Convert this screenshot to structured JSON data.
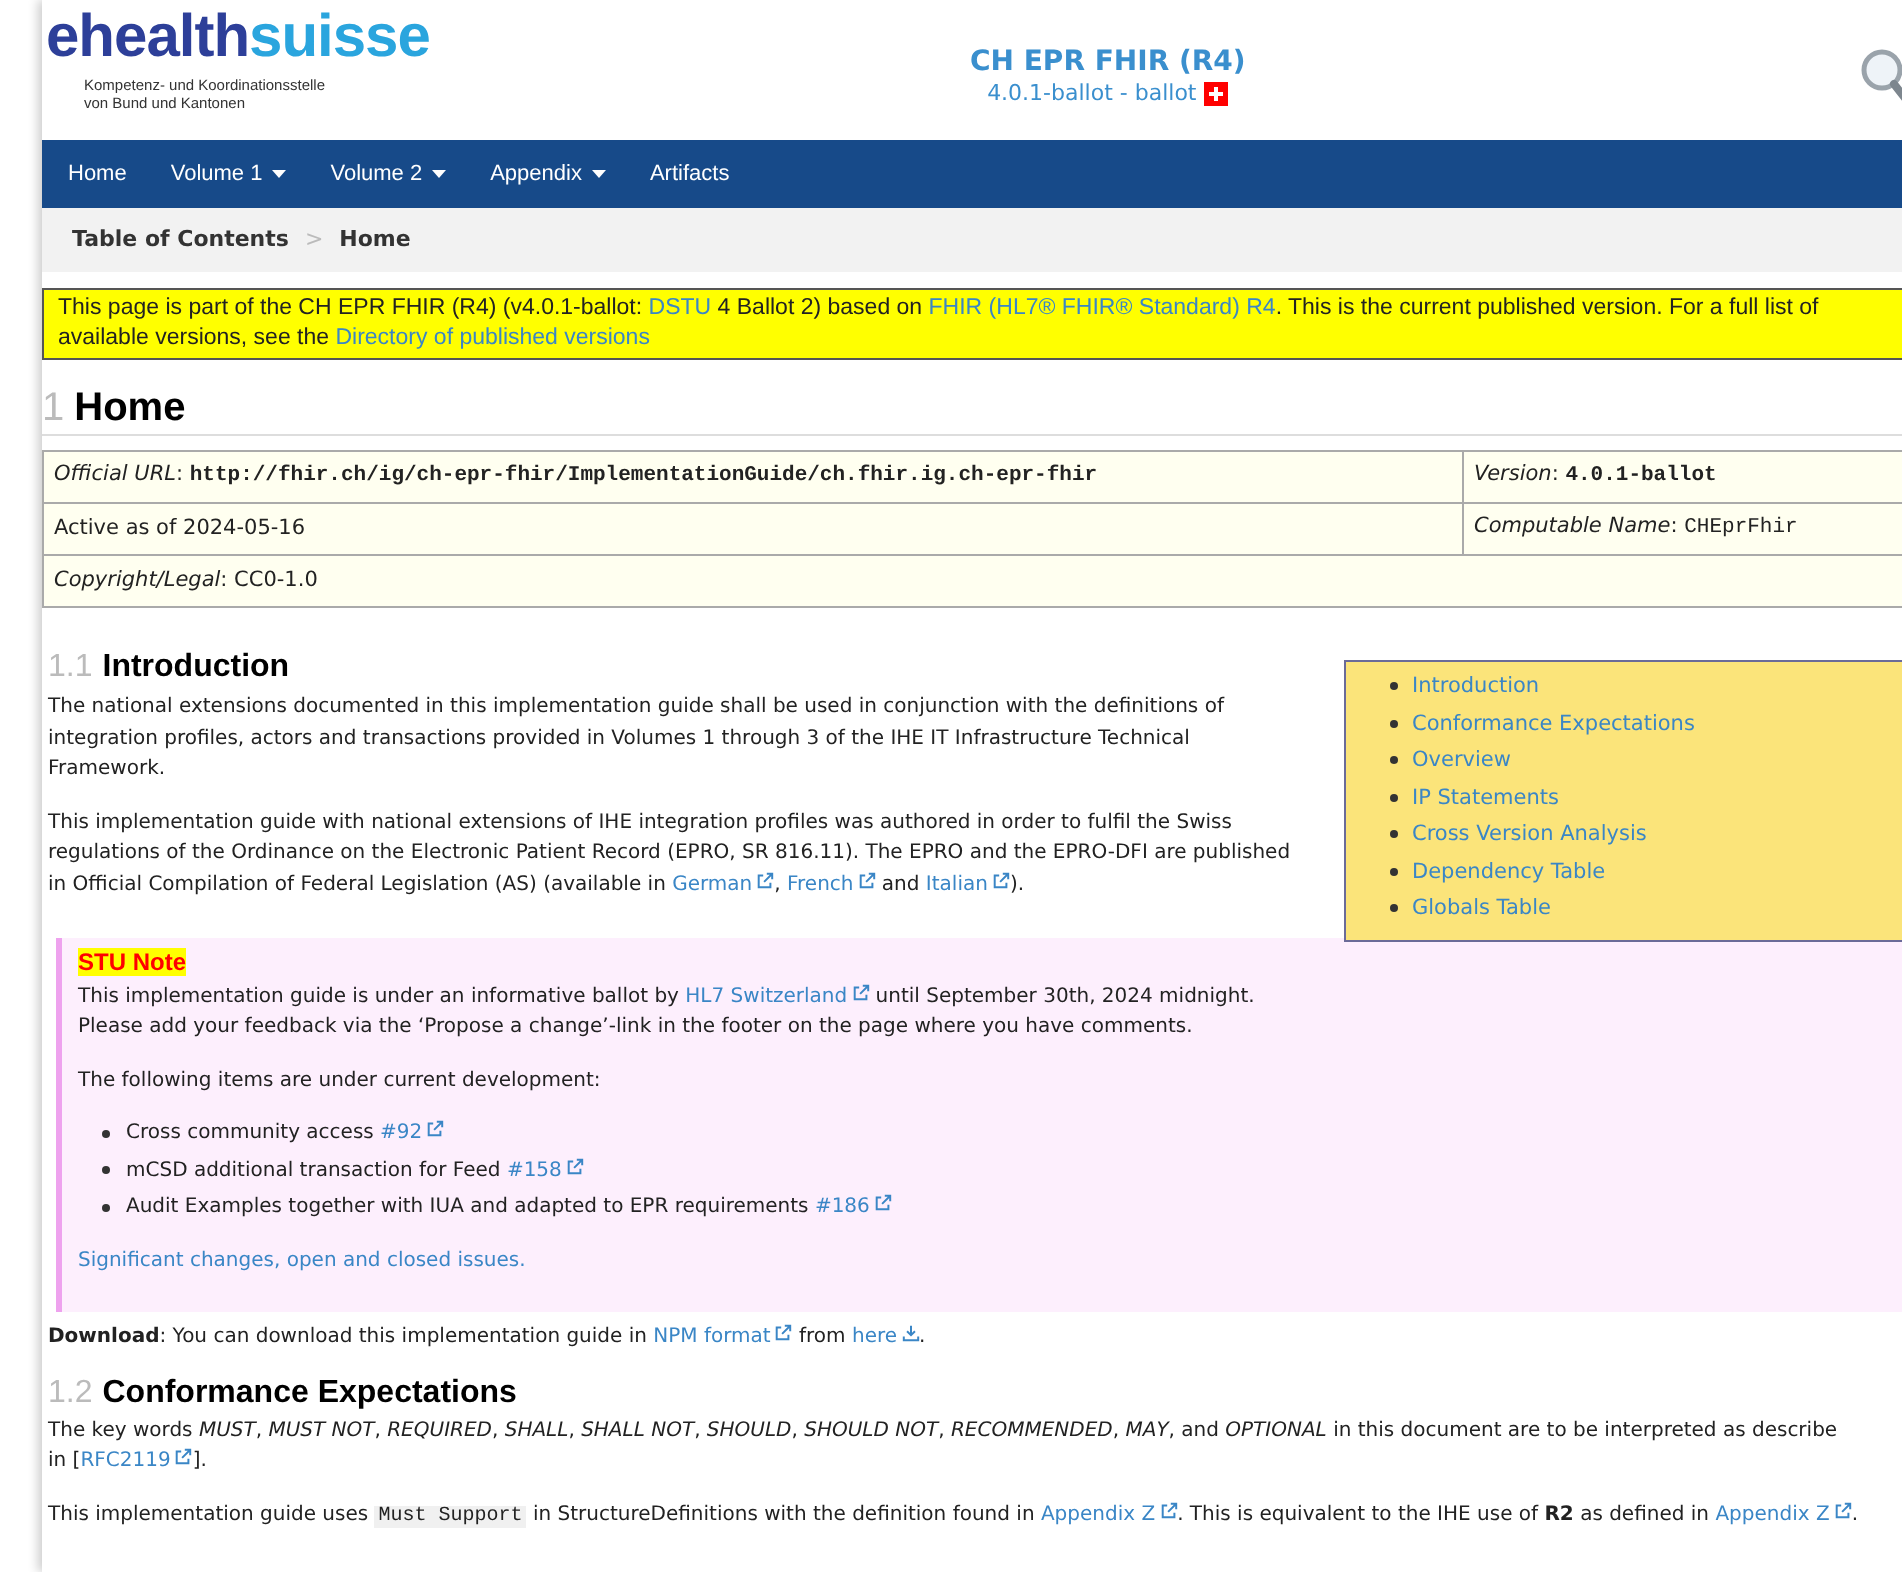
{
  "header": {
    "logo_main": "ehealth",
    "logo_accent": "suisse",
    "logo_subtitle": [
      "Kompetenz- und Koordinationsstelle",
      "von Bund und Kantonen"
    ],
    "title": "CH EPR FHIR (R4)",
    "version": "4.0.1-ballot - ballot"
  },
  "nav": [
    {
      "label": "Home",
      "dropdown": false
    },
    {
      "label": "Volume 1",
      "dropdown": true
    },
    {
      "label": "Volume 2",
      "dropdown": true
    },
    {
      "label": "Appendix",
      "dropdown": true
    },
    {
      "label": "Artifacts",
      "dropdown": false
    }
  ],
  "breadcrumb": {
    "items": [
      "Table of Contents",
      "Home"
    ],
    "separator": ">"
  },
  "banner": [
    [
      "This page is part of the CH EPR FHIR (R4) (v4.0.1-ballot: ",
      {
        "kind": "link",
        "text": "DSTU"
      },
      " 4 Ballot 2) based on ",
      {
        "kind": "link",
        "text": "FHIR (HL7® FHIR® Standard) R4"
      },
      ". This is the current published version. For a full list of"
    ],
    [
      "available versions, see the ",
      {
        "kind": "link",
        "text": "Directory of published versions"
      }
    ]
  ],
  "page_heading": {
    "number": "1",
    "title": "Home"
  },
  "metadata_table": [
    [
      [
        "*Official URL*: ",
        {
          "kind": "mono",
          "text": "**http://fhir.ch/ig/ch-epr-fhir/ImplementationGuide/ch.fhir.ig.ch-epr-fhir**"
        }
      ],
      [
        "*Version*: ",
        {
          "kind": "mono",
          "text": "**4.0.1-ballot**"
        }
      ]
    ],
    [
      [
        "Active as of 2024-05-16"
      ],
      [
        "*Computable Name*: ",
        {
          "kind": "mono",
          "text": "CHEprFhir"
        }
      ]
    ],
    [
      [
        "*Copyright/Legal*: CC0-1.0"
      ]
    ]
  ],
  "intro": {
    "number": "1.1",
    "title": "Introduction",
    "paragraphs": [
      [
        [
          "The national extensions documented in this implementation guide shall be used in conjunction with the definitions of"
        ],
        [
          "integration profiles, actors and transactions provided in Volumes 1 through 3 of the IHE IT Infrastructure Technical"
        ],
        [
          "Framework."
        ]
      ],
      [
        [
          "This implementation guide with national extensions of IHE integration profiles was authored in order to fulfil the Swiss"
        ],
        [
          "regulations of the Ordinance on the Electronic Patient Record (EPRO, SR 816.11). The EPRO and the EPRO-DFI are published"
        ],
        [
          "in Official Compilation of Federal Legislation (AS) (available in ",
          {
            "kind": "extlink",
            "text": "German"
          },
          ", ",
          {
            "kind": "extlink",
            "text": "French"
          },
          " and ",
          {
            "kind": "extlink",
            "text": "Italian"
          },
          ")."
        ]
      ]
    ]
  },
  "toc": [
    "Introduction",
    "Conformance Expectations",
    "Overview",
    "IP Statements",
    "Cross Version Analysis",
    "Dependency Table",
    "Globals Table"
  ],
  "stu_note": {
    "label": "STU Note",
    "blocks": [
      {
        "kind": "paragraph",
        "lines": [
          [
            "This implementation guide is under an informative ballot by ",
            {
              "kind": "extlink",
              "text": "HL7 Switzerland"
            },
            " until September 30th, 2024 midnight."
          ],
          [
            "Please add your feedback via the ‘Propose a change’-link in the footer on the page where you have comments."
          ]
        ]
      },
      {
        "kind": "paragraph",
        "lines": [
          [
            "The following items are under current development:"
          ]
        ]
      },
      {
        "kind": "list",
        "items": [
          [
            "Cross community access ",
            {
              "kind": "extlink",
              "text": "#92"
            }
          ],
          [
            "mCSD additional transaction for Feed ",
            {
              "kind": "extlink",
              "text": "#158"
            }
          ],
          [
            "Audit Examples together with IUA and adapted to EPR requirements ",
            {
              "kind": "extlink",
              "text": "#186"
            }
          ]
        ]
      },
      {
        "kind": "link",
        "text": "Significant changes, open and closed issues."
      }
    ]
  },
  "download": [
    [
      "**Download**: You can download this implementation guide in ",
      {
        "kind": "extlink",
        "text": "NPM format"
      },
      " from ",
      {
        "kind": "dllink",
        "text": "here"
      },
      "."
    ]
  ],
  "conformance": {
    "number": "1.2",
    "title": "Conformance Expectations",
    "paragraphs": [
      [
        [
          "The key words *MUST*, *MUST NOT*, *REQUIRED*, *SHALL*, *SHALL NOT*, *SHOULD*, *SHOULD NOT*, *RECOMMENDED*, *MAY*, and *OPTIONAL* in this document are to be interpreted as describe"
        ],
        [
          "in [",
          {
            "kind": "extlink",
            "text": "RFC2119"
          },
          "]."
        ]
      ],
      [
        [
          "This implementation guide uses ",
          {
            "kind": "code",
            "text": "Must Support"
          },
          " in StructureDefinitions with the definition found in ",
          {
            "kind": "extlink",
            "text": "Appendix Z"
          },
          ". This is equivalent to the IHE use of **R2** as defined in ",
          {
            "kind": "extlink",
            "text": "Appendix Z"
          },
          "."
        ]
      ]
    ]
  }
}
